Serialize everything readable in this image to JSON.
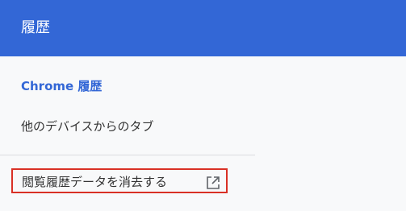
{
  "header": {
    "title": "履歴"
  },
  "sidebar": {
    "items": [
      {
        "label": "Chrome 履歴"
      },
      {
        "label": "他のデバイスからのタブ"
      }
    ],
    "clear_browsing_data": {
      "label": "閲覧履歴データを消去する",
      "icon": "open-in-new-icon"
    }
  },
  "colors": {
    "header_bg": "#3367d6",
    "active_text": "#3367d6",
    "highlight_border": "#d93025"
  }
}
